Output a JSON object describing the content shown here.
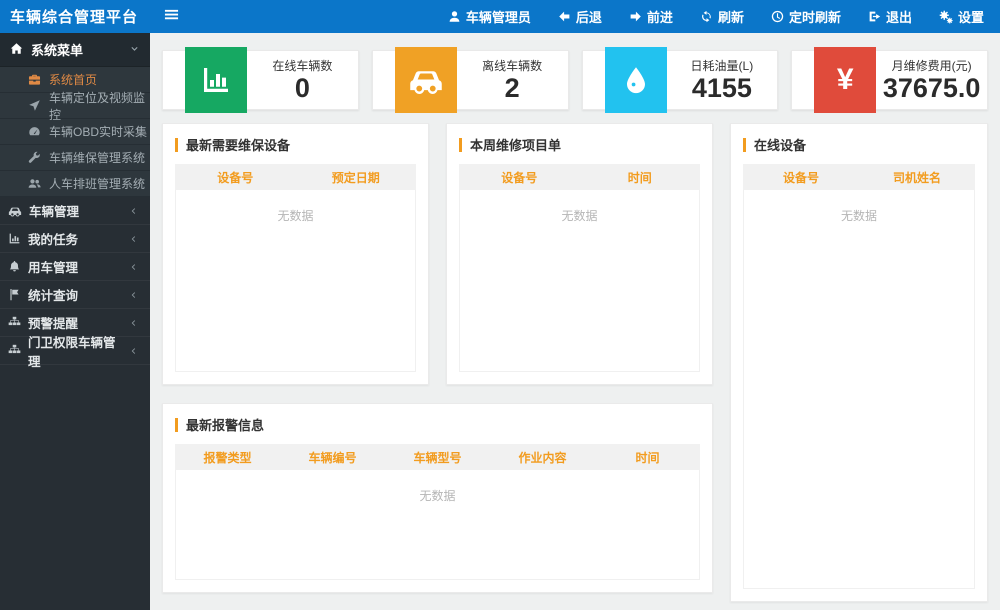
{
  "topbar": {
    "title": "车辆综合管理平台",
    "user": "车辆管理员",
    "back": "后退",
    "forward": "前进",
    "refresh": "刷新",
    "timed_refresh": "定时刷新",
    "logout": "退出",
    "settings": "设置"
  },
  "sidebar": {
    "header": "系统菜单",
    "submenu": [
      {
        "label": "系统首页",
        "icon": "briefcase-icon",
        "active": true
      },
      {
        "label": "车辆定位及视频监控",
        "icon": "location-arrow-icon"
      },
      {
        "label": "车辆OBD实时采集",
        "icon": "dashboard-icon"
      },
      {
        "label": "车辆维保管理系统",
        "icon": "wrench-icon"
      },
      {
        "label": "人车排班管理系统",
        "icon": "users-icon"
      }
    ],
    "items": [
      {
        "label": "车辆管理",
        "icon": "car-icon"
      },
      {
        "label": "我的任务",
        "icon": "bar-chart-icon"
      },
      {
        "label": "用车管理",
        "icon": "bell-icon"
      },
      {
        "label": "统计查询",
        "icon": "flag-icon"
      },
      {
        "label": "预警提醒",
        "icon": "sitemap-icon"
      },
      {
        "label": "门卫权限车辆管理",
        "icon": "sitemap-icon"
      }
    ]
  },
  "stats": [
    {
      "label": "在线车辆数",
      "value": "0",
      "icon": "bar-chart-icon",
      "color": "#16a862"
    },
    {
      "label": "离线车辆数",
      "value": "2",
      "icon": "car-icon",
      "color": "#f0a125"
    },
    {
      "label": "日耗油量(L)",
      "value": "4155",
      "icon": "drop-icon",
      "color": "#22c2ef"
    },
    {
      "label": "月维修费用(元)",
      "value": "37675.0",
      "icon": "yen-icon",
      "icon_glyph": "¥",
      "color": "#e04b3b"
    }
  ],
  "panels": {
    "maintenance": {
      "title": "最新需要维保设备",
      "columns": [
        "设备号",
        "预定日期"
      ],
      "empty": "无数据"
    },
    "weekly": {
      "title": "本周维修项目单",
      "columns": [
        "设备号",
        "时间"
      ],
      "empty": "无数据"
    },
    "online": {
      "title": "在线设备",
      "columns": [
        "设备号",
        "司机姓名"
      ],
      "empty": "无数据"
    },
    "alarms": {
      "title": "最新报警信息",
      "columns": [
        "报警类型",
        "车辆编号",
        "车辆型号",
        "作业内容",
        "时间"
      ],
      "empty": "无数据"
    }
  },
  "colors": {
    "topbar_blue": "#0b76c9",
    "sidebar_dark": "#272e34",
    "sidebar_subitem_bg": "#2e373d",
    "accent_orange": "#f29c1f",
    "active_item_orange": "#e08a45",
    "stat_green": "#16a862",
    "stat_orange": "#f0a125",
    "stat_cyan": "#22c2ef",
    "stat_red": "#e04b3b",
    "content_bg": "#eef0f0"
  }
}
